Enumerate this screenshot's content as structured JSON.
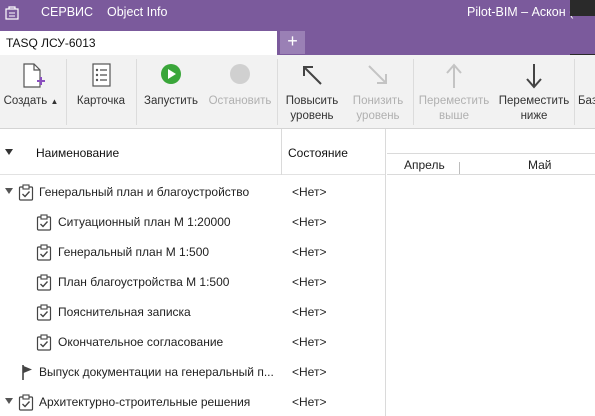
{
  "titlebar": {
    "menu": [
      "СЕРВИС",
      "Object Info"
    ],
    "title": "Pilot-BIM – Аскон (опы",
    "bg_color": "#7b5a9c"
  },
  "tabs": [
    {
      "label": "TASQ ЛСУ-6013",
      "active": true
    }
  ],
  "tab_add_label": "+",
  "toolbar": {
    "create": "Создать",
    "card": "Карточка",
    "start": "Запустить",
    "stop": "Остановить",
    "raise": "Повысить уровень",
    "lower": "Понизить уровень",
    "move_up": "Переместить выше",
    "move_down": "Переместить ниже",
    "base": "Баз"
  },
  "icons": {
    "create": "new-document-icon",
    "card": "card-icon",
    "start": "play-icon",
    "stop": "stop-icon",
    "raise": "arrow-up-left-icon",
    "lower": "arrow-down-right-icon",
    "move_up": "arrow-up-icon",
    "move_down": "arrow-down-icon",
    "task": "clipboard-task-icon",
    "milestone": "flag-icon"
  },
  "colors": {
    "accent": "#7b5a9c",
    "play": "#3aa63a",
    "disabled": "#b0b0b0"
  },
  "tree": {
    "columns": [
      "Наименование",
      "Состояние"
    ],
    "rows": [
      {
        "name": "Генеральный план и благоустройство",
        "state": "<Нет>",
        "level": 0,
        "expanded": true,
        "icon": "clipboard-task-icon"
      },
      {
        "name": "Ситуационный план М 1:20000",
        "state": "<Нет>",
        "level": 1,
        "icon": "clipboard-task-icon"
      },
      {
        "name": "Генеральный план М 1:500",
        "state": "<Нет>",
        "level": 1,
        "icon": "clipboard-task-icon"
      },
      {
        "name": "План благоустройства М 1:500",
        "state": "<Нет>",
        "level": 1,
        "icon": "clipboard-task-icon"
      },
      {
        "name": "Пояснительная записка",
        "state": "<Нет>",
        "level": 1,
        "icon": "clipboard-task-icon"
      },
      {
        "name": "Окончательное согласование",
        "state": "<Нет>",
        "level": 1,
        "icon": "clipboard-task-icon"
      },
      {
        "name": "Выпуск документации на генеральный п...",
        "state": "<Нет>",
        "level": 0,
        "icon": "flag-icon"
      },
      {
        "name": "Архитектурно-строительные решения",
        "state": "<Нет>",
        "level": 0,
        "expanded": true,
        "icon": "clipboard-task-icon"
      }
    ]
  },
  "gantt": {
    "months": [
      "Апрель",
      "Май"
    ]
  }
}
